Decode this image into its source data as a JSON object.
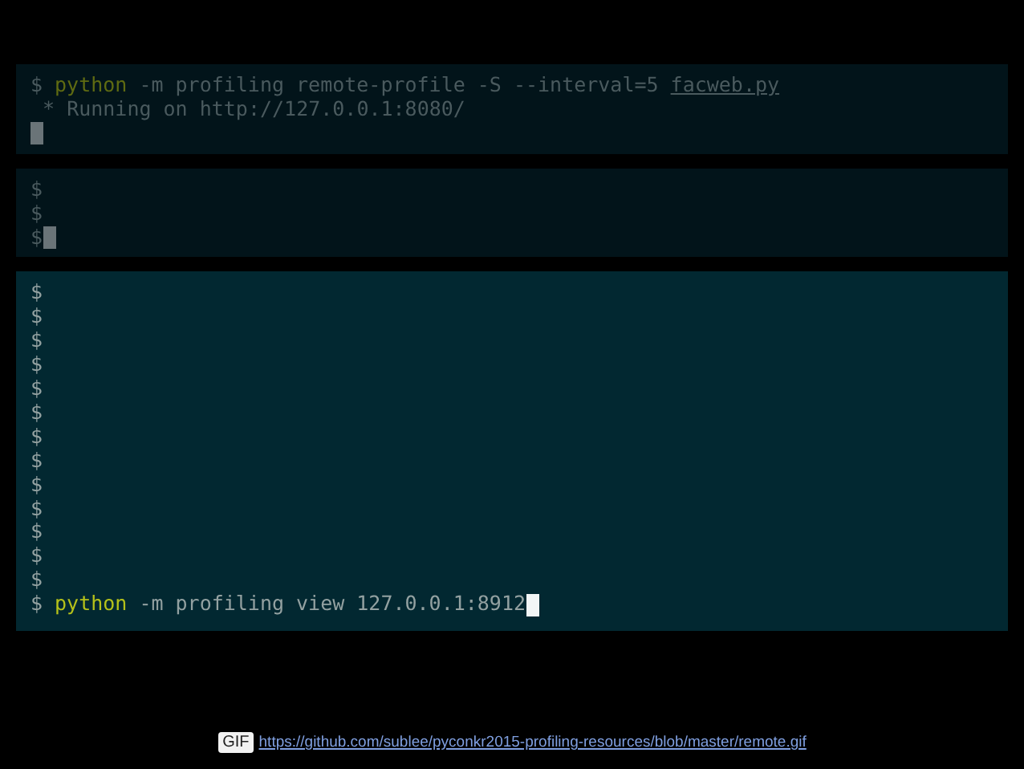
{
  "panes": [
    {
      "active": false,
      "lines": [
        [
          {
            "kind": "prompt",
            "text": "$"
          },
          {
            "kind": "program",
            "text": "python"
          },
          {
            "kind": "plain",
            "text": "-m profiling remote-profile -S --interval=5"
          },
          {
            "kind": "file",
            "text": "facweb.py"
          }
        ],
        [
          {
            "kind": "plain",
            "text": " * Running on http://127.0.0.1:8080/"
          }
        ],
        [
          {
            "kind": "cursor"
          }
        ]
      ]
    },
    {
      "active": false,
      "lines": [
        [
          {
            "kind": "prompt",
            "text": "$"
          }
        ],
        [
          {
            "kind": "prompt",
            "text": "$"
          }
        ],
        [
          {
            "kind": "prompt",
            "text": "$"
          },
          {
            "kind": "cursor"
          }
        ]
      ]
    },
    {
      "active": true,
      "lines": [
        [
          {
            "kind": "prompt",
            "text": "$"
          }
        ],
        [
          {
            "kind": "prompt",
            "text": "$"
          }
        ],
        [
          {
            "kind": "prompt",
            "text": "$"
          }
        ],
        [
          {
            "kind": "prompt",
            "text": "$"
          }
        ],
        [
          {
            "kind": "prompt",
            "text": "$"
          }
        ],
        [
          {
            "kind": "prompt",
            "text": "$"
          }
        ],
        [
          {
            "kind": "prompt",
            "text": "$"
          }
        ],
        [
          {
            "kind": "prompt",
            "text": "$"
          }
        ],
        [
          {
            "kind": "prompt",
            "text": "$"
          }
        ],
        [
          {
            "kind": "prompt",
            "text": "$"
          }
        ],
        [
          {
            "kind": "prompt",
            "text": "$"
          }
        ],
        [
          {
            "kind": "prompt",
            "text": "$"
          }
        ],
        [
          {
            "kind": "prompt",
            "text": "$"
          }
        ],
        [
          {
            "kind": "prompt",
            "text": "$"
          },
          {
            "kind": "program",
            "text": "python"
          },
          {
            "kind": "plain",
            "text": "-m profiling view 127.0.0.1:8912"
          },
          {
            "kind": "cursor"
          }
        ]
      ]
    }
  ],
  "caption": {
    "badge": "GIF",
    "link": "https://github.com/sublee/pyconkr2015-profiling-resources/blob/master/remote.gif"
  }
}
